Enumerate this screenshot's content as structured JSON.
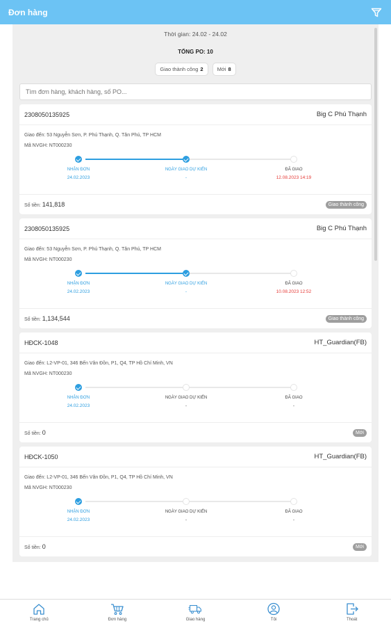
{
  "header": {
    "title": "Đơn hàng",
    "filter_icon": "filter-icon"
  },
  "summary": {
    "period": "Thời gian: 24.02 - 24.02",
    "total": "TỔNG PO: 10",
    "chips": [
      {
        "label": "Giao thành công",
        "count": "2"
      },
      {
        "label": "Mới",
        "count": "8"
      }
    ]
  },
  "search": {
    "placeholder": "Tìm đơn hàng, khách hàng, số PO..."
  },
  "orders": [
    {
      "code": "2308050135925",
      "customer": "Big C Phú Thạnh",
      "address": "Giao đến: 53 Nguyễn Sơn, P. Phú Thạnh, Q. Tân Phú, TP HCM",
      "carrier": "Mã NVGH: NT000230",
      "steps": [
        {
          "label": "NHẬN ĐƠN",
          "value": "24.02.2023",
          "status": "done"
        },
        {
          "label": "NGÀY GIAO DỰ KIẾN",
          "value": "-",
          "status": "done"
        },
        {
          "label": "ĐÃ GIAO",
          "value": "12.08.2023 14:19",
          "status": "todo"
        }
      ],
      "progress": 2,
      "amount_label": "Số tiền:",
      "amount": "141,818",
      "status": "Giao thành công"
    },
    {
      "code": "2308050135925",
      "customer": "Big C Phú Thạnh",
      "address": "Giao đến: 53 Nguyễn Sơn, P. Phú Thạnh, Q. Tân Phú, TP HCM",
      "carrier": "Mã NVGH: NT000230",
      "steps": [
        {
          "label": "NHẬN ĐƠN",
          "value": "24.02.2023",
          "status": "done"
        },
        {
          "label": "NGÀY GIAO DỰ KIẾN",
          "value": "-",
          "status": "done"
        },
        {
          "label": "ĐÃ GIAO",
          "value": "10.08.2023 12:52",
          "status": "todo"
        }
      ],
      "progress": 2,
      "amount_label": "Số tiền:",
      "amount": "1,134,544",
      "status": "Giao thành công"
    },
    {
      "code": "HĐCK-1048",
      "customer": "HT_Guardian(FB)",
      "address": "Giao đến: L2-VP-01, 346 Bến Vân Đồn, P1, Q4, TP Hồ Chí Minh, VN",
      "carrier": "Mã NVGH: NT000230",
      "steps": [
        {
          "label": "NHẬN ĐƠN",
          "value": "24.02.2023",
          "status": "done"
        },
        {
          "label": "NGÀY GIAO DỰ KIẾN",
          "value": "-",
          "status": "todo"
        },
        {
          "label": "ĐÃ GIAO",
          "value": "-",
          "status": "todo"
        }
      ],
      "progress": 1,
      "amount_label": "Số tiền:",
      "amount": "0",
      "status": "Mới"
    },
    {
      "code": "HĐCK-1050",
      "customer": "HT_Guardian(FB)",
      "address": "Giao đến: L2-VP-01, 346 Bến Vân Đồn, P1, Q4, TP Hồ Chí Minh, VN",
      "carrier": "Mã NVGH: NT000230",
      "steps": [
        {
          "label": "NHẬN ĐƠN",
          "value": "24.02.2023",
          "status": "done"
        },
        {
          "label": "NGÀY GIAO DỰ KIẾN",
          "value": "-",
          "status": "todo"
        },
        {
          "label": "ĐÃ GIAO",
          "value": "-",
          "status": "todo"
        }
      ],
      "progress": 1,
      "amount_label": "Số tiền:",
      "amount": "0",
      "status": "Mới"
    }
  ],
  "bottom_nav": [
    {
      "label": "Trang chủ",
      "icon": "home-icon"
    },
    {
      "label": "Đơn hàng",
      "icon": "cart-icon"
    },
    {
      "label": "Giao hàng",
      "icon": "truck-icon"
    },
    {
      "label": "Tôi",
      "icon": "user-icon"
    },
    {
      "label": "Thoát",
      "icon": "logout-icon"
    }
  ],
  "colors": {
    "header": "#6cc3f4",
    "accent": "#2d9ee0",
    "delivered_time": "#e53935",
    "badge": "#9e9e9e",
    "nav_icon": "#3a8fd0"
  }
}
